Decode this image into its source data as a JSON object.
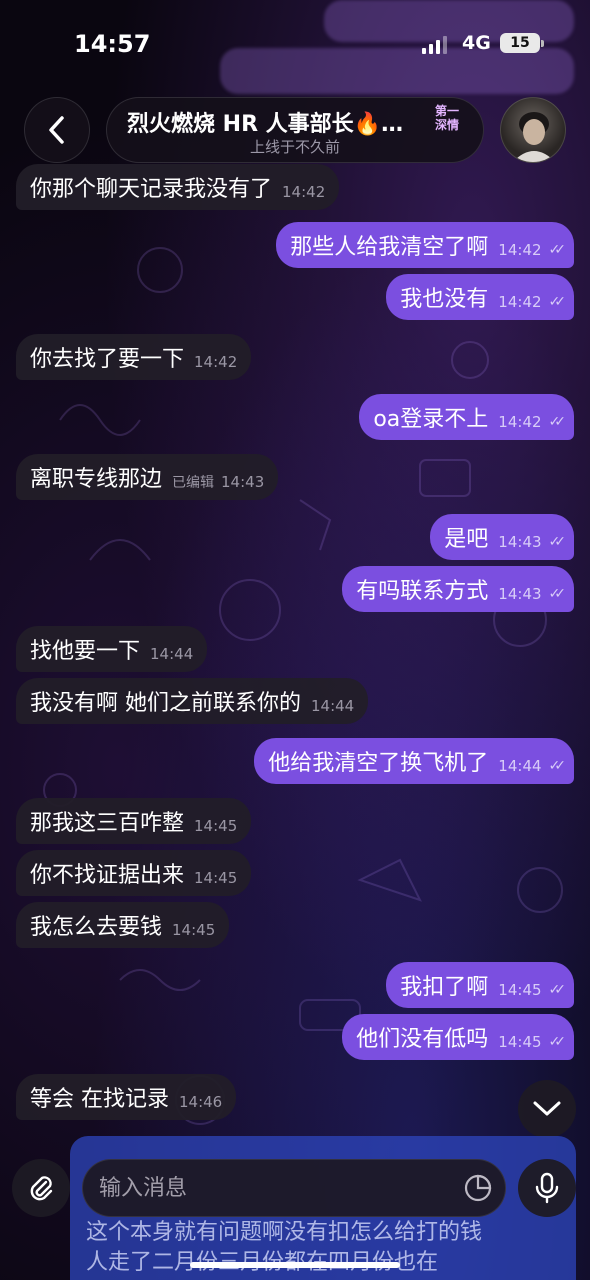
{
  "status_bar": {
    "time": "14:57",
    "network": "4G",
    "battery": "15"
  },
  "header": {
    "title": "烈火燃烧 HR 人事部长🔥…",
    "badge": "第一深情",
    "subtitle": "上线于不久前"
  },
  "messages": [
    {
      "dir": "in",
      "text": "你那个聊天记录我没有了",
      "time": "14:42"
    },
    {
      "dir": "out",
      "text": "那些人给我清空了啊",
      "time": "14:42"
    },
    {
      "dir": "out",
      "text": "我也没有",
      "time": "14:42"
    },
    {
      "dir": "in",
      "text": "你去找了要一下",
      "time": "14:42"
    },
    {
      "dir": "out",
      "text": "oa登录不上",
      "time": "14:42"
    },
    {
      "dir": "in",
      "text": "离职专线那边",
      "edited": "已编辑",
      "time": "14:43"
    },
    {
      "dir": "out",
      "text": "是吧",
      "time": "14:43"
    },
    {
      "dir": "out",
      "text": "有吗联系方式",
      "time": "14:43"
    },
    {
      "dir": "in",
      "text": "找他要一下",
      "time": "14:44"
    },
    {
      "dir": "in",
      "text": "我没有啊 她们之前联系你的",
      "time": "14:44"
    },
    {
      "dir": "out",
      "text": "他给我清空了换飞机了",
      "time": "14:44"
    },
    {
      "dir": "in",
      "text": "那我这三百咋整",
      "time": "14:45"
    },
    {
      "dir": "in",
      "text": "你不找证据出来",
      "time": "14:45"
    },
    {
      "dir": "in",
      "text": "我怎么去要钱",
      "time": "14:45"
    },
    {
      "dir": "out",
      "text": "我扣了啊",
      "time": "14:45"
    },
    {
      "dir": "out",
      "text": "他们没有低吗",
      "time": "14:45"
    },
    {
      "dir": "in",
      "text": "等会 在找记录",
      "time": "14:46"
    }
  ],
  "bottom_preview": {
    "line1": "这个本身就有问题啊没有扣怎么给打的钱",
    "line2": "人走了二月份三月份都在四月份也在"
  },
  "composer": {
    "placeholder": "输入消息"
  },
  "colors": {
    "outgoing": "#7b4fe0",
    "incoming": "#221e28",
    "accent": "#2d46be"
  },
  "icons": [
    "back-arrow-icon",
    "attach-icon",
    "sticker-icon",
    "mic-icon",
    "chevron-down-icon"
  ]
}
